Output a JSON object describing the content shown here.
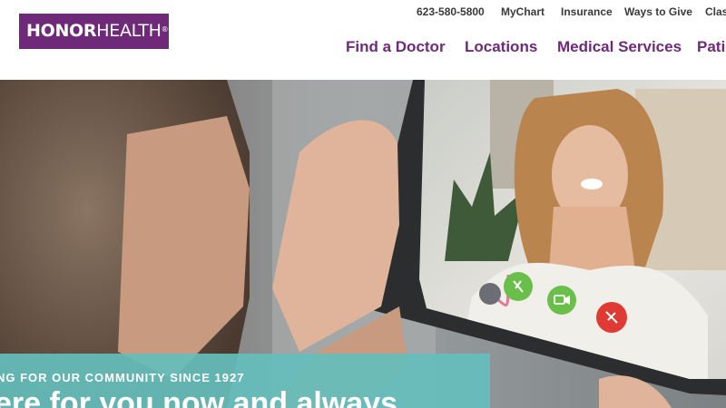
{
  "brand": {
    "logo_part1": "HONOR",
    "logo_part2": "HEALTH",
    "logo_mark": "®",
    "color_primary": "#6e2a79",
    "color_teal": "#65bebc"
  },
  "utility_nav": {
    "phone": "623-580-5800",
    "mychart": "MyChart",
    "insurance": "Insurance",
    "ways_to_give": "Ways to Give",
    "classes": "Class"
  },
  "main_nav": {
    "find_doctor": "Find a Doctor",
    "locations": "Locations",
    "medical_services": "Medical Services",
    "patients": "Patie"
  },
  "hero": {
    "tagline": "NG FOR OUR COMMUNITY SINCE 1927",
    "headline": "ere for you now and always",
    "call_controls": [
      "mic-off-icon",
      "video-icon",
      "end-call-icon"
    ]
  }
}
